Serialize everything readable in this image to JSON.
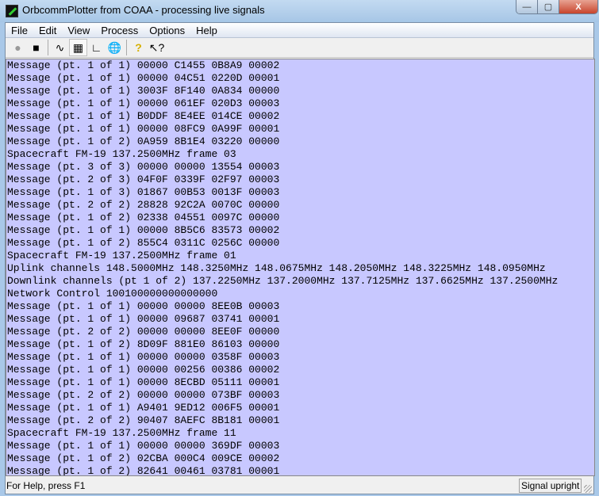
{
  "window": {
    "title": "OrbcommPlotter from COAA - processing live signals",
    "minimize": "—",
    "maximize": "▢",
    "close": "X"
  },
  "menu": [
    "File",
    "Edit",
    "View",
    "Process",
    "Options",
    "Help"
  ],
  "toolbar": [
    {
      "name": "record-icon",
      "glyph": "●",
      "color": "#999999"
    },
    {
      "name": "stop-icon",
      "glyph": "■",
      "color": "#000000"
    },
    {
      "name": "waveform-icon",
      "glyph": "∿",
      "color": "#000000"
    },
    {
      "name": "grid-icon",
      "glyph": "▦",
      "color": "#000000",
      "pressed": true
    },
    {
      "name": "axes-icon",
      "glyph": "∟",
      "color": "#000000"
    },
    {
      "name": "globe-icon",
      "glyph": "🌐",
      "color": "#1a5fd0"
    },
    {
      "name": "help-icon",
      "glyph": "?",
      "color": "#d6b000"
    },
    {
      "name": "context-help-icon",
      "glyph": "↖?",
      "color": "#000000"
    }
  ],
  "lines": [
    "Message (pt. 1 of 1) 00000 C1455 0B8A9 00002",
    "Message (pt. 1 of 1) 00000 04C51 0220D 00001",
    "Message (pt. 1 of 1) 3003F 8F140 0A834 00000",
    "Message (pt. 1 of 1) 00000 061EF 020D3 00003",
    "Message (pt. 1 of 1) B0DDF 8E4EE 014CE 00002",
    "Message (pt. 1 of 1) 00000 08FC9 0A99F 00001",
    "Message (pt. 1 of 2) 0A959 8B1E4 03220 00000",
    "Spacecraft FM-19 137.2500MHz frame 03",
    "Message (pt. 3 of 3) 00000 00000 13554 00003",
    "Message (pt. 2 of 3) 04F0F 0339F 02F97 00003",
    "Message (pt. 1 of 3) 01867 00B53 0013F 00003",
    "Message (pt. 2 of 2) 28828 92C2A 0070C 00000",
    "Message (pt. 1 of 2) 02338 04551 0097C 00000",
    "Message (pt. 1 of 1) 00000 8B5C6 83573 00002",
    "Message (pt. 1 of 2) 855C4 0311C 0256C 00000",
    "Spacecraft FM-19 137.2500MHz frame 01",
    "Uplink channels 148.5000MHz 148.3250MHz 148.0675MHz 148.2050MHz 148.3225MHz 148.0950MHz",
    "Downlink channels (pt 1 of 2) 137.2250MHz 137.2000MHz 137.7125MHz 137.6625MHz 137.2500MHz",
    "Network Control 100100000000000000",
    "Message (pt. 1 of 1) 00000 00000 8EE0B 00003",
    "Message (pt. 1 of 1) 00000 09687 03741 00001",
    "Message (pt. 2 of 2) 00000 00000 8EE0F 00000",
    "Message (pt. 1 of 2) 8D09F 881E0 86103 00000",
    "Message (pt. 1 of 1) 00000 00000 0358F 00003",
    "Message (pt. 1 of 1) 00000 00256 00386 00002",
    "Message (pt. 1 of 1) 00000 8ECBD 05111 00001",
    "Message (pt. 2 of 2) 00000 00000 073BF 00003",
    "Message (pt. 1 of 1) A9401 9ED12 006F5 00001",
    "Message (pt. 2 of 2) 90407 8AEFC 8B181 00001",
    "Spacecraft FM-19 137.2500MHz frame 11",
    "Message (pt. 1 of 1) 00000 00000 369DF 00003",
    "Message (pt. 1 of 2) 02CBA 000C4 009CE 00002",
    "Message (pt. 1 of 2) 82641 00461 03781 00001"
  ],
  "status": {
    "left": "For Help, press F1",
    "right": "Signal upright"
  }
}
